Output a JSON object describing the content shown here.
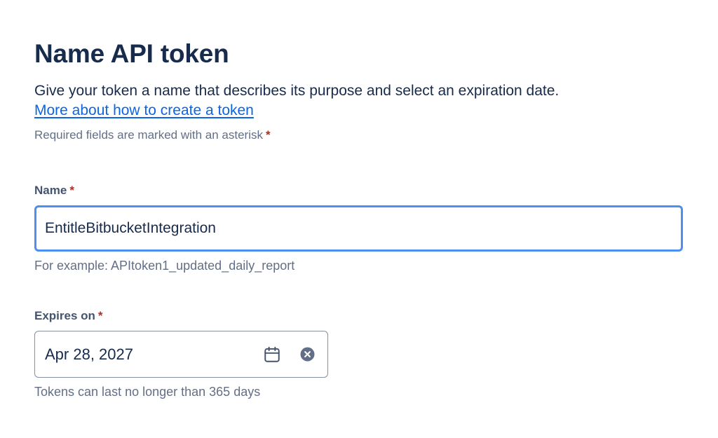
{
  "header": {
    "title": "Name API token",
    "description": "Give your token a name that describes its purpose and select an expiration date.",
    "help_link": "More about how to create a token",
    "required_note": "Required fields are marked with an asterisk",
    "asterisk": "*"
  },
  "name_field": {
    "label": "Name",
    "value": "EntitleBitbucketIntegration",
    "helper": "For example: APItoken1_updated_daily_report"
  },
  "expires_field": {
    "label": "Expires on",
    "value": "Apr 28, 2027",
    "helper": "Tokens can last no longer than 365 days",
    "icons": [
      "calendar-icon",
      "clear-icon"
    ]
  },
  "colors": {
    "heading": "#172b4d",
    "link": "#0c66e4",
    "asterisk": "#ae2e24",
    "focus_border": "#4c8ff0",
    "muted": "#626f86"
  }
}
